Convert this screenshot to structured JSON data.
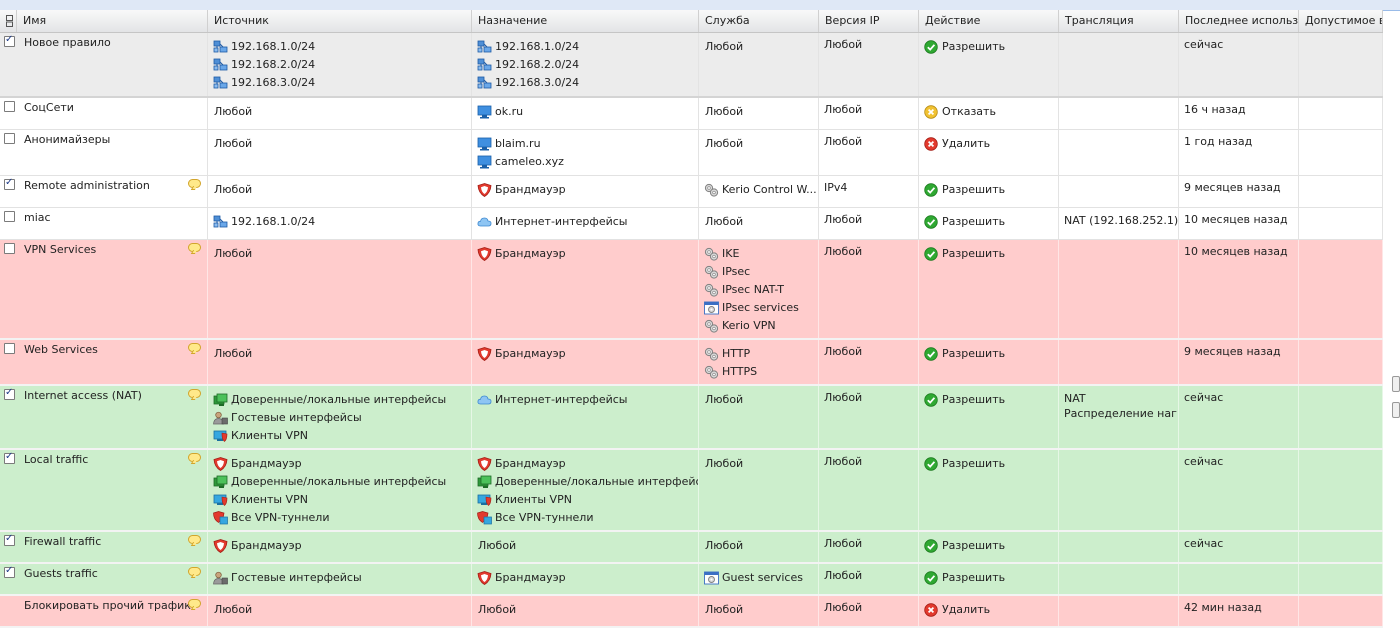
{
  "columns": [
    "Имя",
    "Источник",
    "Назначение",
    "Служба",
    "Версия IP",
    "Действие",
    "Трансляция",
    "Последнее использ...",
    "Допустимое вр"
  ],
  "rows": [
    {
      "style": "new",
      "height": 65,
      "checked": true,
      "comment": false,
      "name": "Новое правило",
      "source": [
        {
          "icon": "network-icon",
          "text": "192.168.1.0/24"
        },
        {
          "icon": "network-icon",
          "text": "192.168.2.0/24"
        },
        {
          "icon": "network-icon",
          "text": "192.168.3.0/24"
        }
      ],
      "dest": [
        {
          "icon": "network-icon",
          "text": "192.168.1.0/24"
        },
        {
          "icon": "network-icon",
          "text": "192.168.2.0/24"
        },
        {
          "icon": "network-icon",
          "text": "192.168.3.0/24"
        }
      ],
      "service": [
        {
          "icon": "",
          "text": "Любой"
        }
      ],
      "ipver": "Любой",
      "action": {
        "icon": "allow-icon",
        "text": "Разрешить"
      },
      "translation": [],
      "lastused": "сейчас"
    },
    {
      "style": "white",
      "height": 32,
      "checked": false,
      "comment": false,
      "name": "СоцСети",
      "source": [
        {
          "icon": "",
          "text": "Любой"
        }
      ],
      "dest": [
        {
          "icon": "host-icon",
          "text": "ok.ru"
        }
      ],
      "service": [
        {
          "icon": "",
          "text": "Любой"
        }
      ],
      "ipver": "Любой",
      "action": {
        "icon": "deny-icon",
        "text": "Отказать"
      },
      "translation": [],
      "lastused": "16 ч назад"
    },
    {
      "style": "white",
      "height": 46,
      "checked": false,
      "comment": false,
      "name": "Анонимайзеры",
      "source": [
        {
          "icon": "",
          "text": "Любой"
        }
      ],
      "dest": [
        {
          "icon": "host-icon",
          "text": "blaim.ru"
        },
        {
          "icon": "host-icon",
          "text": "cameleo.xyz"
        }
      ],
      "service": [
        {
          "icon": "",
          "text": "Любой"
        }
      ],
      "ipver": "Любой",
      "action": {
        "icon": "drop-icon",
        "text": "Удалить"
      },
      "translation": [],
      "lastused": "1 год назад"
    },
    {
      "style": "white",
      "height": 32,
      "checked": true,
      "comment": true,
      "name": "Remote administration",
      "source": [
        {
          "icon": "",
          "text": "Любой"
        }
      ],
      "dest": [
        {
          "icon": "firewall-icon",
          "text": "Брандмауэр"
        }
      ],
      "service": [
        {
          "icon": "service-icon",
          "text": "Kerio Control W..."
        }
      ],
      "ipver": "IPv4",
      "action": {
        "icon": "allow-icon",
        "text": "Разрешить"
      },
      "translation": [],
      "lastused": "9 месяцев назад"
    },
    {
      "style": "white",
      "height": 32,
      "checked": false,
      "comment": false,
      "name": "miac",
      "source": [
        {
          "icon": "network-icon",
          "text": "192.168.1.0/24"
        }
      ],
      "dest": [
        {
          "icon": "cloud-icon",
          "text": "Интернет-интерфейсы"
        }
      ],
      "service": [
        {
          "icon": "",
          "text": "Любой"
        }
      ],
      "ipver": "Любой",
      "action": {
        "icon": "allow-icon",
        "text": "Разрешить"
      },
      "translation": [
        "NAT (192.168.252.1)"
      ],
      "lastused": "10 месяцев назад"
    },
    {
      "style": "red",
      "height": 100,
      "checked": false,
      "comment": true,
      "name": "VPN Services",
      "source": [
        {
          "icon": "",
          "text": "Любой"
        }
      ],
      "dest": [
        {
          "icon": "firewall-icon",
          "text": "Брандмауэр"
        }
      ],
      "service": [
        {
          "icon": "service-icon",
          "text": "IKE"
        },
        {
          "icon": "service-icon",
          "text": "IPsec"
        },
        {
          "icon": "service-icon",
          "text": "IPsec NAT-T"
        },
        {
          "icon": "service-group-icon",
          "text": "IPsec services"
        },
        {
          "icon": "service-icon",
          "text": "Kerio VPN"
        }
      ],
      "ipver": "Любой",
      "action": {
        "icon": "allow-icon",
        "text": "Разрешить"
      },
      "translation": [],
      "lastused": "10 месяцев назад"
    },
    {
      "style": "red",
      "height": 46,
      "checked": false,
      "comment": true,
      "name": "Web Services",
      "source": [
        {
          "icon": "",
          "text": "Любой"
        }
      ],
      "dest": [
        {
          "icon": "firewall-icon",
          "text": "Брандмауэр"
        }
      ],
      "service": [
        {
          "icon": "service-icon",
          "text": "HTTP"
        },
        {
          "icon": "service-icon",
          "text": "HTTPS"
        }
      ],
      "ipver": "Любой",
      "action": {
        "icon": "allow-icon",
        "text": "Разрешить"
      },
      "translation": [],
      "lastused": "9 месяцев назад"
    },
    {
      "style": "green",
      "height": 64,
      "checked": true,
      "comment": true,
      "name": "Internet access (NAT)",
      "source": [
        {
          "icon": "trusted-iface-icon",
          "text": "Доверенные/локальные интерфейсы"
        },
        {
          "icon": "guest-iface-icon",
          "text": "Гостевые интерфейсы"
        },
        {
          "icon": "vpn-clients-icon",
          "text": "Клиенты VPN"
        }
      ],
      "dest": [
        {
          "icon": "cloud-icon",
          "text": "Интернет-интерфейсы"
        }
      ],
      "service": [
        {
          "icon": "",
          "text": "Любой"
        }
      ],
      "ipver": "Любой",
      "action": {
        "icon": "allow-icon",
        "text": "Разрешить"
      },
      "translation": [
        "NAT",
        "Распределение наг..."
      ],
      "lastused": "сейчас"
    },
    {
      "style": "green",
      "height": 82,
      "checked": true,
      "comment": true,
      "name": "Local traffic",
      "source": [
        {
          "icon": "firewall-icon",
          "text": "Брандмауэр"
        },
        {
          "icon": "trusted-iface-icon",
          "text": "Доверенные/локальные интерфейсы"
        },
        {
          "icon": "vpn-clients-icon",
          "text": "Клиенты VPN"
        },
        {
          "icon": "vpn-tunnels-icon",
          "text": "Все VPN-туннели"
        }
      ],
      "dest": [
        {
          "icon": "firewall-icon",
          "text": "Брандмауэр"
        },
        {
          "icon": "trusted-iface-icon",
          "text": "Доверенные/локальные интерфейсы"
        },
        {
          "icon": "vpn-clients-icon",
          "text": "Клиенты VPN"
        },
        {
          "icon": "vpn-tunnels-icon",
          "text": "Все VPN-туннели"
        }
      ],
      "service": [
        {
          "icon": "",
          "text": "Любой"
        }
      ],
      "ipver": "Любой",
      "action": {
        "icon": "allow-icon",
        "text": "Разрешить"
      },
      "translation": [],
      "lastused": "сейчас"
    },
    {
      "style": "green",
      "height": 32,
      "checked": true,
      "comment": true,
      "name": "Firewall traffic",
      "source": [
        {
          "icon": "firewall-icon",
          "text": "Брандмауэр"
        }
      ],
      "dest": [
        {
          "icon": "",
          "text": "Любой"
        }
      ],
      "service": [
        {
          "icon": "",
          "text": "Любой"
        }
      ],
      "ipver": "Любой",
      "action": {
        "icon": "allow-icon",
        "text": "Разрешить"
      },
      "translation": [],
      "lastused": "сейчас"
    },
    {
      "style": "green",
      "height": 32,
      "checked": true,
      "comment": true,
      "name": "Guests traffic",
      "source": [
        {
          "icon": "guest-iface-icon",
          "text": "Гостевые интерфейсы"
        }
      ],
      "dest": [
        {
          "icon": "firewall-icon",
          "text": "Брандмауэр"
        }
      ],
      "service": [
        {
          "icon": "service-group-icon",
          "text": "Guest services"
        }
      ],
      "ipver": "Любой",
      "action": {
        "icon": "allow-icon",
        "text": "Разрешить"
      },
      "translation": [],
      "lastused": ""
    },
    {
      "style": "red",
      "height": 32,
      "checked": null,
      "comment": true,
      "name": "Блокировать прочий трафик",
      "source": [
        {
          "icon": "",
          "text": "Любой"
        }
      ],
      "dest": [
        {
          "icon": "",
          "text": "Любой"
        }
      ],
      "service": [
        {
          "icon": "",
          "text": "Любой"
        }
      ],
      "ipver": "Любой",
      "action": {
        "icon": "drop-icon",
        "text": "Удалить"
      },
      "translation": [],
      "lastused": "42 мин назад"
    }
  ]
}
